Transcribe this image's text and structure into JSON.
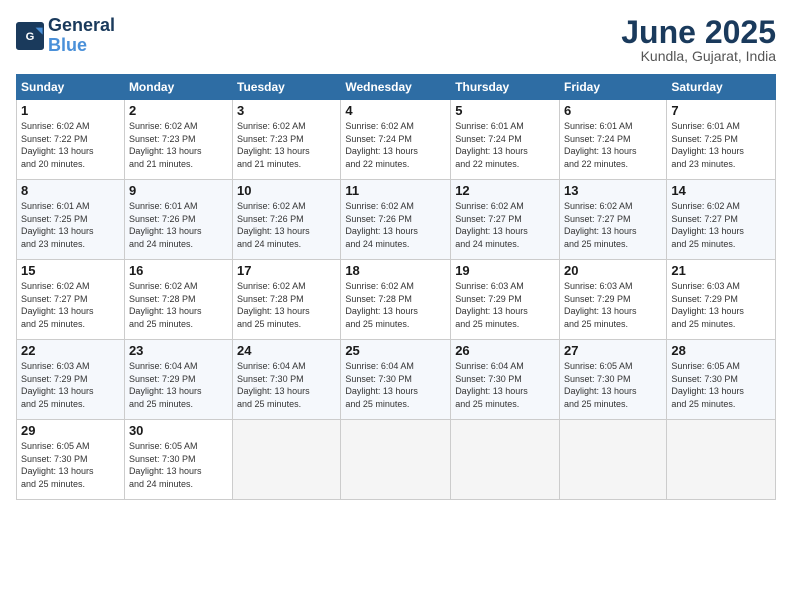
{
  "logo": {
    "line1": "General",
    "line2": "Blue"
  },
  "title": "June 2025",
  "subtitle": "Kundla, Gujarat, India",
  "days_header": [
    "Sunday",
    "Monday",
    "Tuesday",
    "Wednesday",
    "Thursday",
    "Friday",
    "Saturday"
  ],
  "weeks": [
    [
      {
        "num": "1",
        "info": "Sunrise: 6:02 AM\nSunset: 7:22 PM\nDaylight: 13 hours\nand 20 minutes."
      },
      {
        "num": "2",
        "info": "Sunrise: 6:02 AM\nSunset: 7:23 PM\nDaylight: 13 hours\nand 21 minutes."
      },
      {
        "num": "3",
        "info": "Sunrise: 6:02 AM\nSunset: 7:23 PM\nDaylight: 13 hours\nand 21 minutes."
      },
      {
        "num": "4",
        "info": "Sunrise: 6:02 AM\nSunset: 7:24 PM\nDaylight: 13 hours\nand 22 minutes."
      },
      {
        "num": "5",
        "info": "Sunrise: 6:01 AM\nSunset: 7:24 PM\nDaylight: 13 hours\nand 22 minutes."
      },
      {
        "num": "6",
        "info": "Sunrise: 6:01 AM\nSunset: 7:24 PM\nDaylight: 13 hours\nand 22 minutes."
      },
      {
        "num": "7",
        "info": "Sunrise: 6:01 AM\nSunset: 7:25 PM\nDaylight: 13 hours\nand 23 minutes."
      }
    ],
    [
      {
        "num": "8",
        "info": "Sunrise: 6:01 AM\nSunset: 7:25 PM\nDaylight: 13 hours\nand 23 minutes."
      },
      {
        "num": "9",
        "info": "Sunrise: 6:01 AM\nSunset: 7:26 PM\nDaylight: 13 hours\nand 24 minutes."
      },
      {
        "num": "10",
        "info": "Sunrise: 6:02 AM\nSunset: 7:26 PM\nDaylight: 13 hours\nand 24 minutes."
      },
      {
        "num": "11",
        "info": "Sunrise: 6:02 AM\nSunset: 7:26 PM\nDaylight: 13 hours\nand 24 minutes."
      },
      {
        "num": "12",
        "info": "Sunrise: 6:02 AM\nSunset: 7:27 PM\nDaylight: 13 hours\nand 24 minutes."
      },
      {
        "num": "13",
        "info": "Sunrise: 6:02 AM\nSunset: 7:27 PM\nDaylight: 13 hours\nand 25 minutes."
      },
      {
        "num": "14",
        "info": "Sunrise: 6:02 AM\nSunset: 7:27 PM\nDaylight: 13 hours\nand 25 minutes."
      }
    ],
    [
      {
        "num": "15",
        "info": "Sunrise: 6:02 AM\nSunset: 7:27 PM\nDaylight: 13 hours\nand 25 minutes."
      },
      {
        "num": "16",
        "info": "Sunrise: 6:02 AM\nSunset: 7:28 PM\nDaylight: 13 hours\nand 25 minutes."
      },
      {
        "num": "17",
        "info": "Sunrise: 6:02 AM\nSunset: 7:28 PM\nDaylight: 13 hours\nand 25 minutes."
      },
      {
        "num": "18",
        "info": "Sunrise: 6:02 AM\nSunset: 7:28 PM\nDaylight: 13 hours\nand 25 minutes."
      },
      {
        "num": "19",
        "info": "Sunrise: 6:03 AM\nSunset: 7:29 PM\nDaylight: 13 hours\nand 25 minutes."
      },
      {
        "num": "20",
        "info": "Sunrise: 6:03 AM\nSunset: 7:29 PM\nDaylight: 13 hours\nand 25 minutes."
      },
      {
        "num": "21",
        "info": "Sunrise: 6:03 AM\nSunset: 7:29 PM\nDaylight: 13 hours\nand 25 minutes."
      }
    ],
    [
      {
        "num": "22",
        "info": "Sunrise: 6:03 AM\nSunset: 7:29 PM\nDaylight: 13 hours\nand 25 minutes."
      },
      {
        "num": "23",
        "info": "Sunrise: 6:04 AM\nSunset: 7:29 PM\nDaylight: 13 hours\nand 25 minutes."
      },
      {
        "num": "24",
        "info": "Sunrise: 6:04 AM\nSunset: 7:30 PM\nDaylight: 13 hours\nand 25 minutes."
      },
      {
        "num": "25",
        "info": "Sunrise: 6:04 AM\nSunset: 7:30 PM\nDaylight: 13 hours\nand 25 minutes."
      },
      {
        "num": "26",
        "info": "Sunrise: 6:04 AM\nSunset: 7:30 PM\nDaylight: 13 hours\nand 25 minutes."
      },
      {
        "num": "27",
        "info": "Sunrise: 6:05 AM\nSunset: 7:30 PM\nDaylight: 13 hours\nand 25 minutes."
      },
      {
        "num": "28",
        "info": "Sunrise: 6:05 AM\nSunset: 7:30 PM\nDaylight: 13 hours\nand 25 minutes."
      }
    ],
    [
      {
        "num": "29",
        "info": "Sunrise: 6:05 AM\nSunset: 7:30 PM\nDaylight: 13 hours\nand 25 minutes."
      },
      {
        "num": "30",
        "info": "Sunrise: 6:05 AM\nSunset: 7:30 PM\nDaylight: 13 hours\nand 24 minutes."
      },
      {
        "num": "",
        "info": ""
      },
      {
        "num": "",
        "info": ""
      },
      {
        "num": "",
        "info": ""
      },
      {
        "num": "",
        "info": ""
      },
      {
        "num": "",
        "info": ""
      }
    ]
  ]
}
